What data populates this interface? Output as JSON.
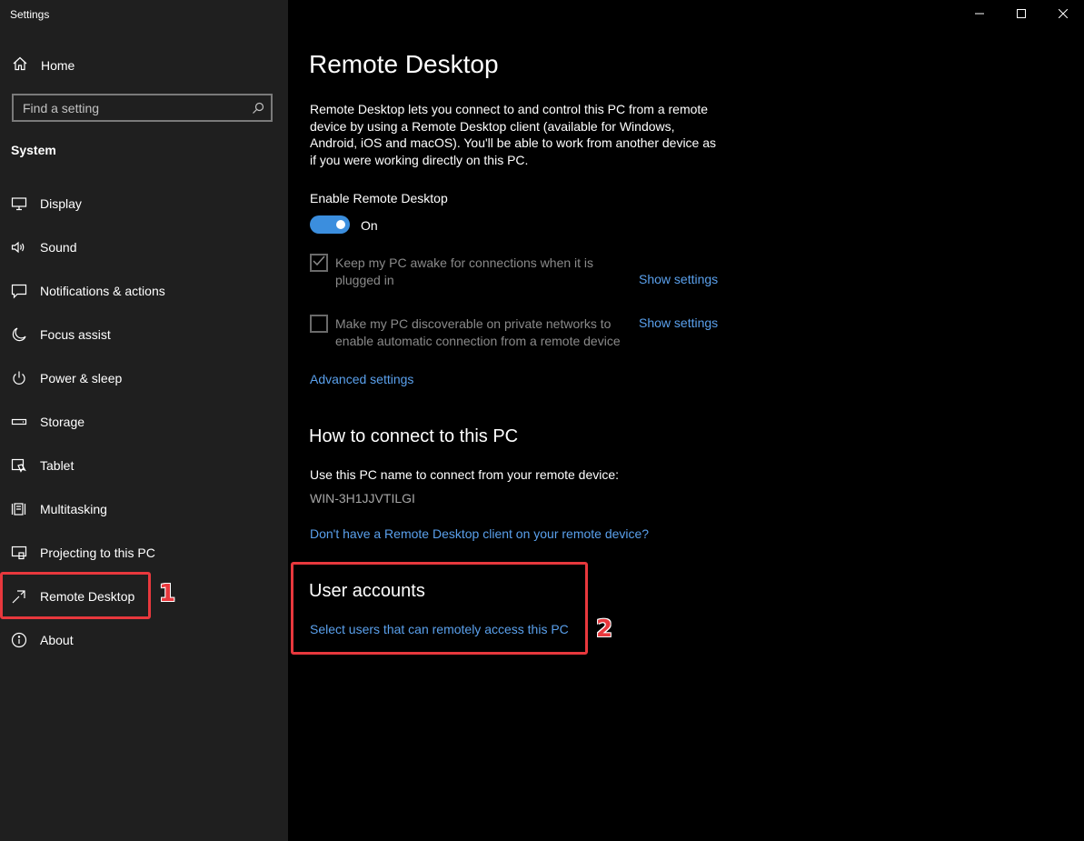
{
  "window": {
    "app_title": "Settings",
    "controls": [
      "minimize-icon",
      "maximize-icon",
      "close-icon"
    ]
  },
  "sidebar": {
    "home_label": "Home",
    "search": {
      "placeholder": "Find a setting",
      "value": ""
    },
    "section_header": "System",
    "items": [
      {
        "label": "Display",
        "icon": "display-icon"
      },
      {
        "label": "Sound",
        "icon": "sound-icon"
      },
      {
        "label": "Notifications & actions",
        "icon": "notifications-icon"
      },
      {
        "label": "Focus assist",
        "icon": "moon-icon"
      },
      {
        "label": "Power & sleep",
        "icon": "power-icon"
      },
      {
        "label": "Storage",
        "icon": "storage-icon"
      },
      {
        "label": "Tablet",
        "icon": "tablet-icon"
      },
      {
        "label": "Multitasking",
        "icon": "multitasking-icon"
      },
      {
        "label": "Projecting to this PC",
        "icon": "projecting-icon"
      },
      {
        "label": "Remote Desktop",
        "icon": "remote-desktop-icon",
        "selected": true
      },
      {
        "label": "About",
        "icon": "info-icon"
      }
    ]
  },
  "main": {
    "title": "Remote Desktop",
    "description": "Remote Desktop lets you connect to and control this PC from a remote device by using a Remote Desktop client (available for Windows, Android, iOS and macOS). You'll be able to work from another device as if you were working directly on this PC.",
    "enable_label": "Enable Remote Desktop",
    "toggle_state": "On",
    "keep_awake": {
      "text": "Keep my PC awake for connections when it is plugged in",
      "checked": true,
      "link": "Show settings"
    },
    "discoverable": {
      "text": "Make my PC discoverable on private networks to enable automatic connection from a remote device",
      "checked": false,
      "link": "Show settings"
    },
    "advanced_link": "Advanced settings",
    "connect_heading": "How to connect to this PC",
    "connect_text": "Use this PC name to connect from your remote device:",
    "pc_name": "WIN-3H1JJVTILGI",
    "client_link": "Don't have a Remote Desktop client on your remote device?",
    "user_accounts_heading": "User accounts",
    "user_accounts_link": "Select users that can remotely access this PC"
  },
  "annotations": {
    "marker_1": "1",
    "marker_2": "2"
  },
  "colors": {
    "accent": "#3b8ede",
    "link": "#5aa0ec",
    "annotation": "#e8383d",
    "sidebar_bg": "#1f1f1f",
    "main_bg": "#000000"
  }
}
